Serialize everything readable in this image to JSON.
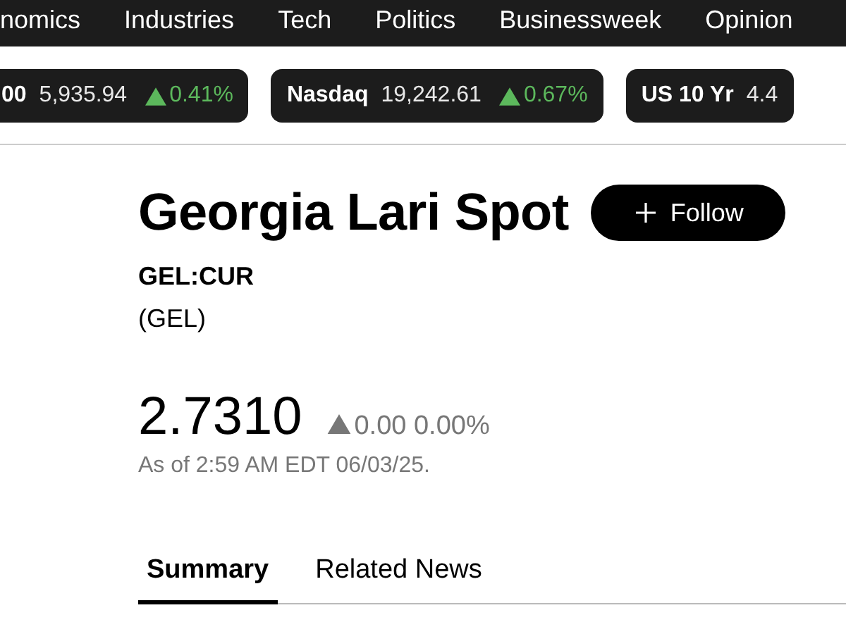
{
  "nav": {
    "items": [
      "nomics",
      "Industries",
      "Tech",
      "Politics",
      "Businessweek",
      "Opinion"
    ]
  },
  "tickers": [
    {
      "name": "00",
      "value": "5,935.94",
      "color": "#5cb85c",
      "change": "0.41%"
    },
    {
      "name": "Nasdaq",
      "value": "19,242.61",
      "color": "#5cb85c",
      "change": "0.67%"
    },
    {
      "name": "US 10 Yr",
      "value": "4.4"
    }
  ],
  "quote": {
    "title": "Georgia Lari Spot",
    "follow_button": "Follow",
    "symbol": "GEL:CUR",
    "currency": "(GEL)",
    "price": "2.7310",
    "color": "#777777",
    "change": "0.00 0.00%",
    "as_of": "As of 2:59 AM EDT 06/03/25."
  },
  "tabs": [
    {
      "label": "Summary",
      "selected": true
    },
    {
      "label": "Related News",
      "selected": false
    }
  ]
}
